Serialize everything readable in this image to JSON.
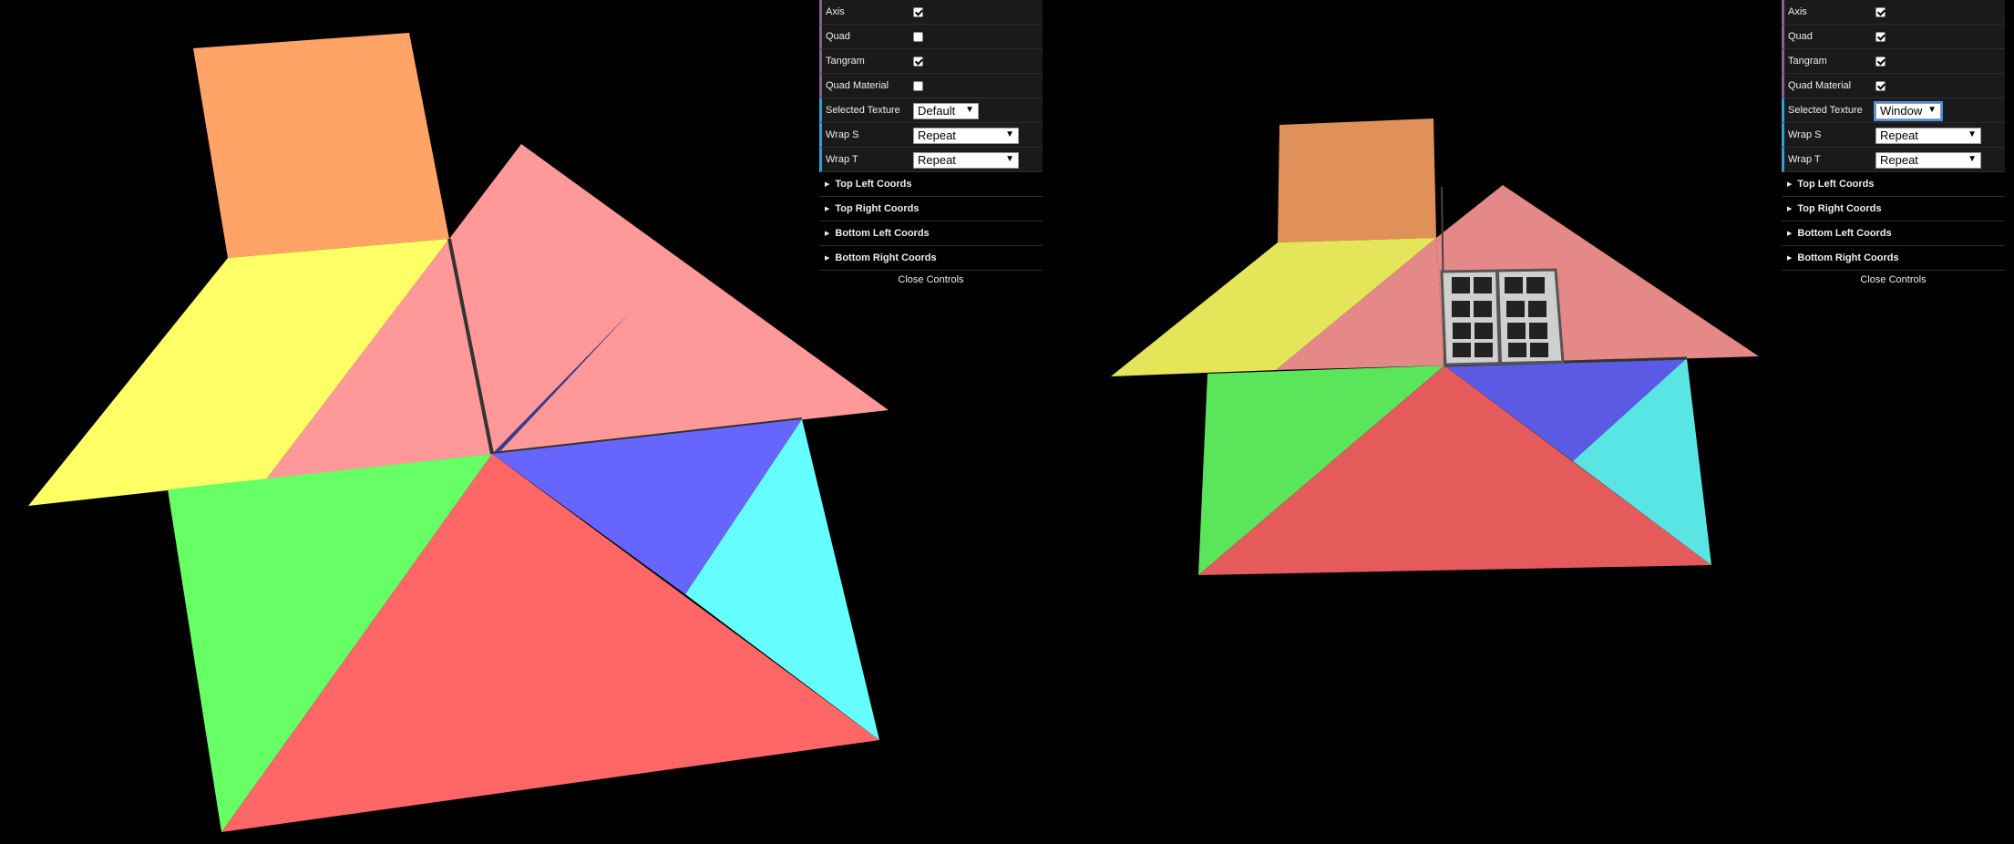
{
  "left_panel": {
    "axis_label": "Axis",
    "axis_checked": true,
    "quad_label": "Quad",
    "quad_checked": false,
    "tangram_label": "Tangram",
    "tangram_checked": true,
    "quad_material_label": "Quad Material",
    "quad_material_checked": false,
    "selected_texture_label": "Selected Texture",
    "selected_texture_value": "Default",
    "wrap_s_label": "Wrap S",
    "wrap_s_value": "Repeat",
    "wrap_t_label": "Wrap T",
    "wrap_t_value": "Repeat",
    "folders": [
      "Top Left Coords",
      "Top Right Coords",
      "Bottom Left Coords",
      "Bottom Right Coords"
    ],
    "close_label": "Close Controls"
  },
  "right_panel": {
    "axis_label": "Axis",
    "axis_checked": true,
    "quad_label": "Quad",
    "quad_checked": true,
    "tangram_label": "Tangram",
    "tangram_checked": true,
    "quad_material_label": "Quad Material",
    "quad_material_checked": true,
    "selected_texture_label": "Selected Texture",
    "selected_texture_value": "Window",
    "wrap_s_label": "Wrap S",
    "wrap_s_value": "Repeat",
    "wrap_t_label": "Wrap T",
    "wrap_t_value": "Repeat",
    "folders": [
      "Top Left Coords",
      "Top Right Coords",
      "Bottom Left Coords",
      "Bottom Right Coords"
    ],
    "close_label": "Close Controls"
  },
  "colors": {
    "background": "#000000",
    "orange": "#ffa366",
    "yellow": "#ffff66",
    "pink": "#ff9999",
    "green": "#66ff66",
    "red": "#ff6666",
    "blue": "#6666ff",
    "cyan": "#66ffff"
  },
  "icons": {
    "folder_arrow": "triangle-right-icon",
    "select_arrow": "chevron-down-icon"
  }
}
